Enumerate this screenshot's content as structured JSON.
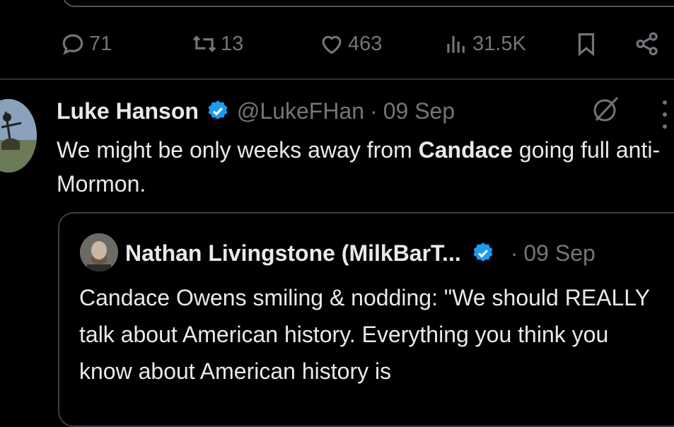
{
  "actions": {
    "replies": "71",
    "reposts": "13",
    "likes": "463",
    "views": "31.5K"
  },
  "tweet": {
    "author_name": "Luke Hanson",
    "handle": "@LukeFHan",
    "separator": "·",
    "date": "09 Sep",
    "text_before": "We might be only weeks away from ",
    "text_bold": "Candace",
    "text_after": " going full anti-Mormon."
  },
  "quote": {
    "author_name": "Nathan Livingstone (MilkBarT...",
    "separator": "·",
    "date": "09 Sep",
    "text": "Candace Owens smiling & nodding: \"We should REALLY talk about American history. Everything you think you know about American history is"
  },
  "colors": {
    "background": "#000000",
    "text": "#e7e9ea",
    "muted": "#71767b",
    "verified": "#1d9bf0",
    "divider": "#2f3336"
  },
  "icons": [
    "reply-icon",
    "repost-icon",
    "like-icon",
    "views-icon",
    "bookmark-icon",
    "share-icon",
    "verified-badge-icon",
    "grok-icon",
    "more-icon"
  ]
}
